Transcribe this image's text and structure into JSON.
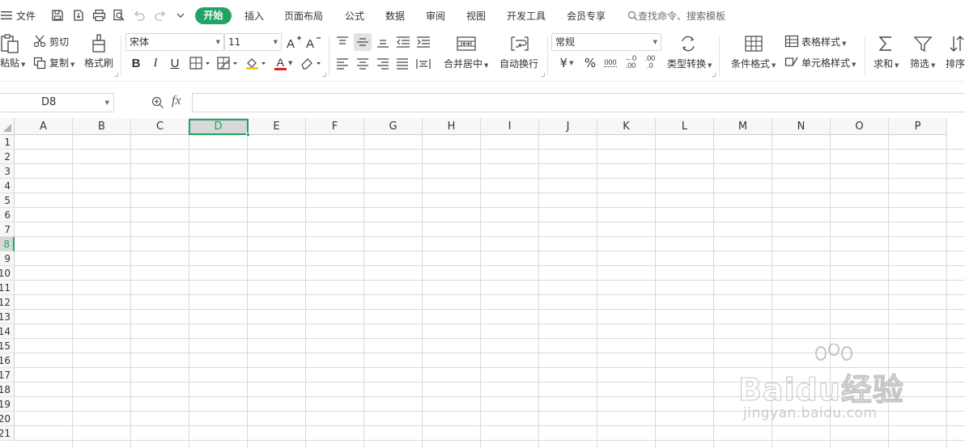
{
  "menu": {
    "file_label": "文件",
    "tabs": [
      "开始",
      "插入",
      "页面布局",
      "公式",
      "数据",
      "审阅",
      "视图",
      "开发工具",
      "会员专享"
    ],
    "active_tab": "开始",
    "search_placeholder": "查找命令、搜索模板"
  },
  "ribbon": {
    "paste_label": "粘贴",
    "cut_label": "剪切",
    "copy_label": "复制",
    "format_painter_label": "格式刷",
    "font_name": "宋体",
    "font_size": "11",
    "merge_center_label": "合并居中",
    "wrap_text_label": "自动换行",
    "number_format": "常规",
    "type_convert_label": "类型转换",
    "conditional_format_label": "条件格式",
    "table_style_label": "表格样式",
    "cell_style_label": "单元格样式",
    "sum_label": "求和",
    "filter_label": "筛选",
    "sort_label": "排序",
    "bold_glyph": "B",
    "italic_glyph": "I",
    "underline_glyph": "U",
    "font_color_glyph": "A",
    "currency_glyph": "¥",
    "percent_glyph": "%",
    "thousands_glyph": "000",
    "increase_decimal_glyph": ".00",
    "decrease_decimal_glyph": ".0"
  },
  "formula_bar": {
    "name_box": "D8",
    "fx_label": "fx",
    "value": ""
  },
  "sheet": {
    "columns": [
      "A",
      "B",
      "C",
      "D",
      "E",
      "F",
      "G",
      "H",
      "I",
      "J",
      "K",
      "L",
      "M",
      "N",
      "O",
      "P"
    ],
    "rows": [
      "1",
      "2",
      "3",
      "4",
      "5",
      "6",
      "7",
      "8",
      "9",
      "10",
      "11",
      "12",
      "13",
      "14",
      "15",
      "16",
      "17",
      "18",
      "19",
      "20",
      "21"
    ],
    "selected_column": "D",
    "selected_row": "8"
  },
  "watermark": {
    "brand": "Baidu经验",
    "url": "jingyan.baidu.com"
  },
  "colors": {
    "accent": "#1fa463",
    "grid_line": "#d4dbe3",
    "header_bg": "#f7f7f7"
  }
}
